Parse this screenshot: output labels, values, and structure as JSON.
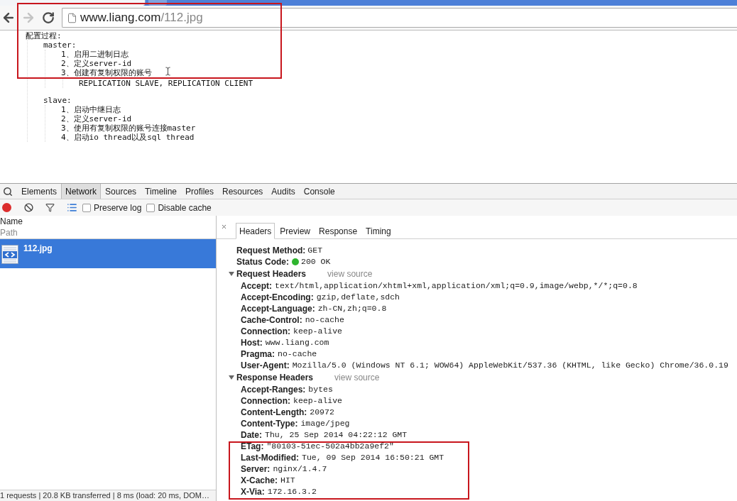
{
  "browser": {
    "back": {
      "disabled": false
    },
    "forward": {
      "disabled": true
    },
    "address": {
      "host": "www.liang.com",
      "path": "/112.jpg"
    }
  },
  "page": {
    "outline": [
      {
        "text": "配置过程:",
        "children": [
          {
            "text": "master:",
            "children": [
              {
                "text": "1、启用二进制日志"
              },
              {
                "text": "2、定义server-id"
              },
              {
                "text": "3、创建有复制权限的账号",
                "children": [
                  {
                    "text": "REPLICATION SLAVE, REPLICATION CLIENT"
                  }
                ]
              }
            ]
          },
          {
            "text": "slave:",
            "children": [
              {
                "text": "1、启动中继日志"
              },
              {
                "text": "2、定义server-id"
              },
              {
                "text": "3、使用有复制权限的账号连接master"
              },
              {
                "text": "4、启动io thread以及sql thread"
              }
            ]
          }
        ]
      }
    ]
  },
  "devtools": {
    "tabs": [
      {
        "label": "Elements",
        "selected": false
      },
      {
        "label": "Network",
        "selected": true
      },
      {
        "label": "Sources",
        "selected": false
      },
      {
        "label": "Timeline",
        "selected": false
      },
      {
        "label": "Profiles",
        "selected": false
      },
      {
        "label": "Resources",
        "selected": false
      },
      {
        "label": "Audits",
        "selected": false
      },
      {
        "label": "Console",
        "selected": false
      }
    ],
    "toolbar": {
      "recording": true,
      "options": [
        {
          "label": "Preserve log",
          "checked": false
        },
        {
          "label": "Disable cache",
          "checked": false
        }
      ]
    },
    "requests": {
      "header": {
        "name": "Name",
        "path": "Path"
      },
      "rows": [
        {
          "name": "112.jpg",
          "selected": true
        }
      ],
      "summary": "1 requests | 20.8 KB transferred | 8 ms (load: 20 ms, DOM…"
    },
    "details": {
      "tabs": [
        {
          "label": "Headers",
          "selected": true
        },
        {
          "label": "Preview",
          "selected": false
        },
        {
          "label": "Response",
          "selected": false
        },
        {
          "label": "Timing",
          "selected": false
        }
      ],
      "general": [
        {
          "name": "Request Method:",
          "value": "GET"
        },
        {
          "name": "Status Code:",
          "value": "200 OK",
          "color": "#2fb52f"
        }
      ],
      "sections": [
        {
          "title": "Request Headers",
          "link": "view source",
          "expanded": true,
          "headers": [
            {
              "name": "Accept:",
              "value": "text/html,application/xhtml+xml,application/xml;q=0.9,image/webp,*/*;q=0.8"
            },
            {
              "name": "Accept-Encoding:",
              "value": "gzip,deflate,sdch"
            },
            {
              "name": "Accept-Language:",
              "value": "zh-CN,zh;q=0.8"
            },
            {
              "name": "Cache-Control:",
              "value": "no-cache"
            },
            {
              "name": "Connection:",
              "value": "keep-alive"
            },
            {
              "name": "Host:",
              "value": "www.liang.com"
            },
            {
              "name": "Pragma:",
              "value": "no-cache"
            },
            {
              "name": "User-Agent:",
              "value": "Mozilla/5.0 (Windows NT 6.1; WOW64) AppleWebKit/537.36 (KHTML, like Gecko) Chrome/36.0.19"
            }
          ]
        },
        {
          "title": "Response Headers",
          "link": "view source",
          "expanded": true,
          "headers": [
            {
              "name": "Accept-Ranges:",
              "value": "bytes"
            },
            {
              "name": "Connection:",
              "value": "keep-alive"
            },
            {
              "name": "Content-Length:",
              "value": "20972"
            },
            {
              "name": "Content-Type:",
              "value": "image/jpeg"
            },
            {
              "name": "Date:",
              "value": "Thu, 25 Sep 2014 04:22:12 GMT"
            },
            {
              "name": "ETag:",
              "value": "\"80103-51ec-502a4bb2a9ef2\""
            },
            {
              "name": "Last-Modified:",
              "value": "Tue, 09 Sep 2014 16:50:21 GMT"
            },
            {
              "name": "Server:",
              "value": "nginx/1.4.7"
            },
            {
              "name": "X-Cache:",
              "value": "HIT"
            },
            {
              "name": "X-Via:",
              "value": "172.16.3.2"
            }
          ]
        }
      ]
    }
  }
}
